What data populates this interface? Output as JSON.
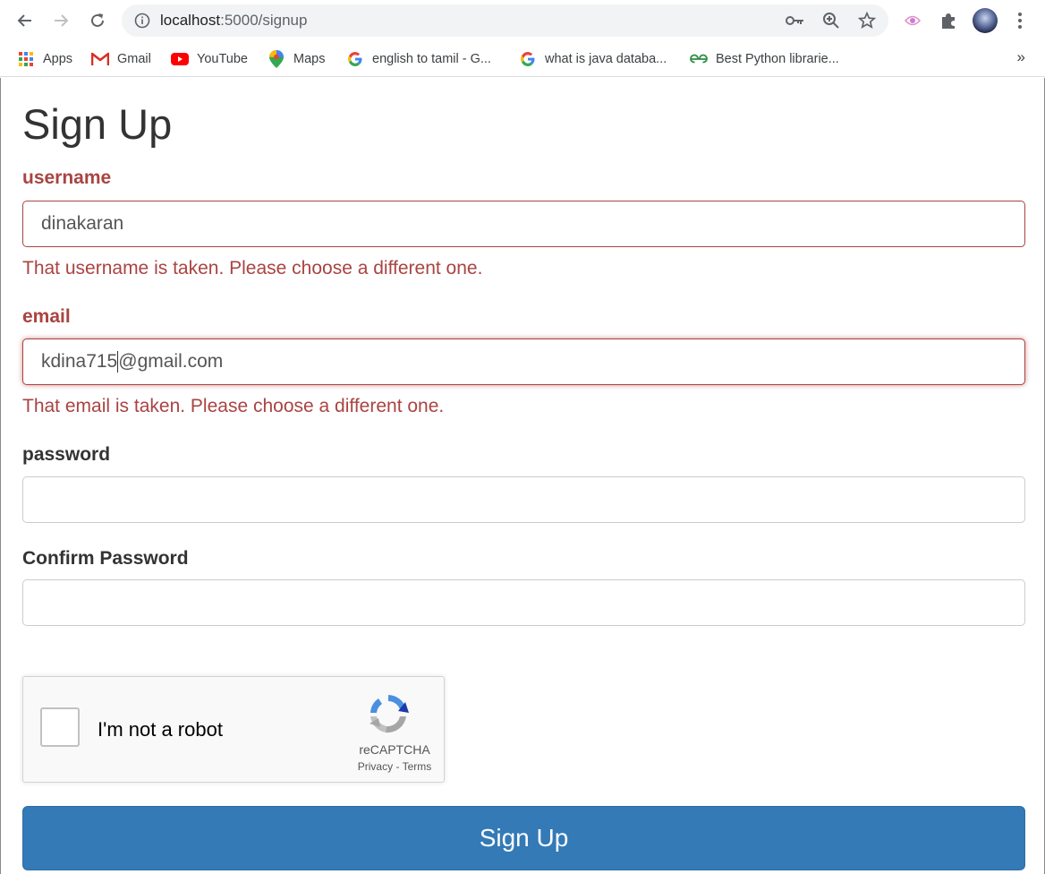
{
  "browser": {
    "url_host": "localhost",
    "url_rest": ":5000/signup",
    "bookmarks": [
      {
        "label": "Apps",
        "icon": "apps-grid-icon"
      },
      {
        "label": "Gmail",
        "icon": "gmail-icon"
      },
      {
        "label": "YouTube",
        "icon": "youtube-icon"
      },
      {
        "label": "Maps",
        "icon": "maps-icon"
      },
      {
        "label": "english to tamil - G...",
        "icon": "google-icon"
      },
      {
        "label": "what is java databa...",
        "icon": "google-icon"
      },
      {
        "label": "Best Python librarie...",
        "icon": "geeksforgeeks-icon"
      }
    ],
    "more_bookmarks": "»"
  },
  "form": {
    "title": "Sign Up",
    "username": {
      "label": "username",
      "value": "dinakaran",
      "error": "That username is taken. Please choose a different one."
    },
    "email": {
      "label": "email",
      "value_before_caret": "kdina715",
      "value_after_caret": "@gmail.com",
      "error": "That email is taken. Please choose a different one."
    },
    "password": {
      "label": "password",
      "value": ""
    },
    "confirm_password": {
      "label": "Confirm Password",
      "value": ""
    },
    "recaptcha": {
      "label": "I'm not a robot",
      "brand": "reCAPTCHA",
      "privacy": "Privacy",
      "separator": "-",
      "terms": "Terms"
    },
    "submit_label": "Sign Up"
  },
  "colors": {
    "error": "#a94442",
    "primary_button": "#337ab7",
    "text": "#333333"
  }
}
